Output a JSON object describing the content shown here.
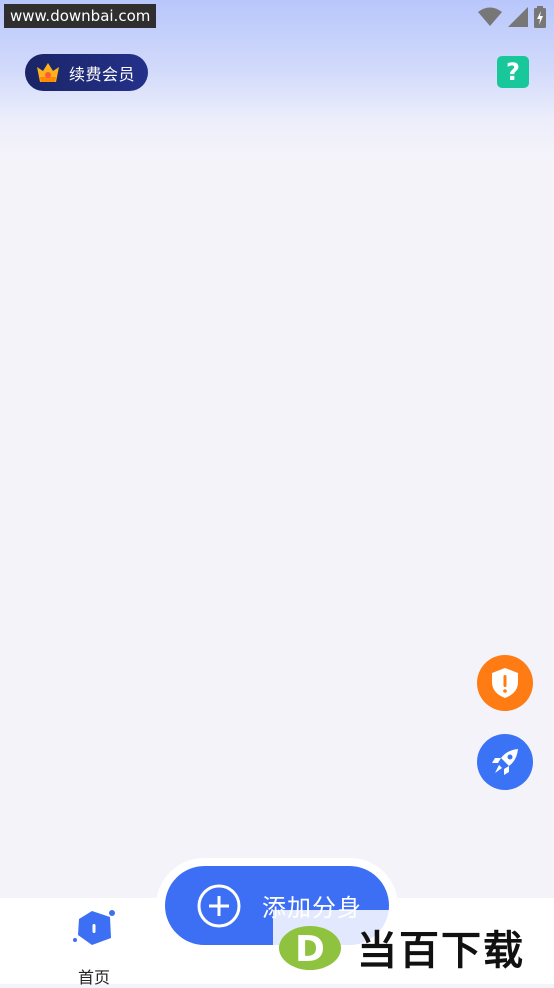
{
  "watermark": {
    "url": "www.downbai.com",
    "logo_text": "当百下载"
  },
  "header": {
    "vip_label": "续费会员",
    "help_icon": "question-mark-icon"
  },
  "floating_actions": {
    "shield_icon": "shield-alert-icon",
    "rocket_icon": "rocket-icon"
  },
  "add_button": {
    "label": "添加分身"
  },
  "bottom_nav": {
    "home_label": "首页"
  },
  "colors": {
    "accent": "#3d6ff4",
    "help_green": "#18c79a",
    "warning_orange": "#ff7b13",
    "vip_navy": "#1a2566"
  }
}
